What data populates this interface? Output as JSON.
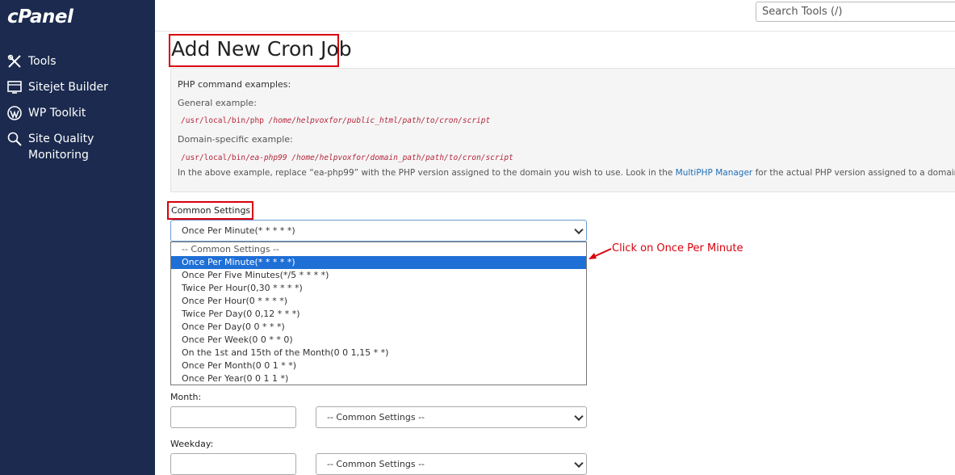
{
  "sidebar": {
    "logo": "cPanel",
    "items": [
      {
        "label": "Tools",
        "icon": "tools-icon"
      },
      {
        "label": "Sitejet Builder",
        "icon": "sitejet-icon"
      },
      {
        "label": "WP Toolkit",
        "icon": "wordpress-icon"
      },
      {
        "label": "Site Quality Monitoring",
        "icon": "magnifier-icon",
        "line1": "Site Quality",
        "line2": "Monitoring"
      }
    ]
  },
  "header": {
    "search_placeholder": "Search Tools (/)"
  },
  "page": {
    "title": "Add New Cron Job"
  },
  "examples": {
    "heading": "PHP command examples:",
    "general_label": "General example:",
    "general_code_plain": "/usr/local/bin/php ",
    "general_code_italic": "/home/helpvoxfor/public_html/path/to/cron/script",
    "domain_label": "Domain-specific example:",
    "domain_code_plain": "/usr/local/bin/",
    "domain_code_italic_1": "ea-php99",
    "domain_code_mid": " ",
    "domain_code_italic_2": "/home/helpvoxfor/domain_path/path/to/cron/script",
    "note_before": "In the above example, replace “ea-php99” with the PHP version assigned to the domain you wish to use. Look in the ",
    "note_link": "MultiPHP Manager",
    "note_after": " for the actual PHP version assigned to a domain."
  },
  "common_settings": {
    "label": "Common Settings",
    "selected_value": "Once Per Minute(* * * * *)",
    "options": [
      "-- Common Settings --",
      "Once Per Minute(* * * * *)",
      "Once Per Five Minutes(*/5 * * * *)",
      "Twice Per Hour(0,30 * * * *)",
      "Once Per Hour(0 * * * *)",
      "Twice Per Day(0 0,12 * * *)",
      "Once Per Day(0 0 * * *)",
      "Once Per Week(0 0 * * 0)",
      "On the 1st and 15th of the Month(0 0 1,15 * *)",
      "Once Per Month(0 0 1 * *)",
      "Once Per Year(0 0 1 1 *)"
    ],
    "highlighted_index": 1
  },
  "annotation": {
    "text": "Click on Once Per Minute",
    "color": "#d9000d"
  },
  "fields": {
    "month": {
      "label": "Month:",
      "select_value": "-- Common Settings --"
    },
    "weekday": {
      "label": "Weekday:",
      "select_value": "-- Common Settings --"
    }
  },
  "colors": {
    "sidebar_bg": "#1b2a4e",
    "highlight_red": "#d9000d",
    "selected_option": "#1e6fd6",
    "link": "#1e6fb8"
  }
}
